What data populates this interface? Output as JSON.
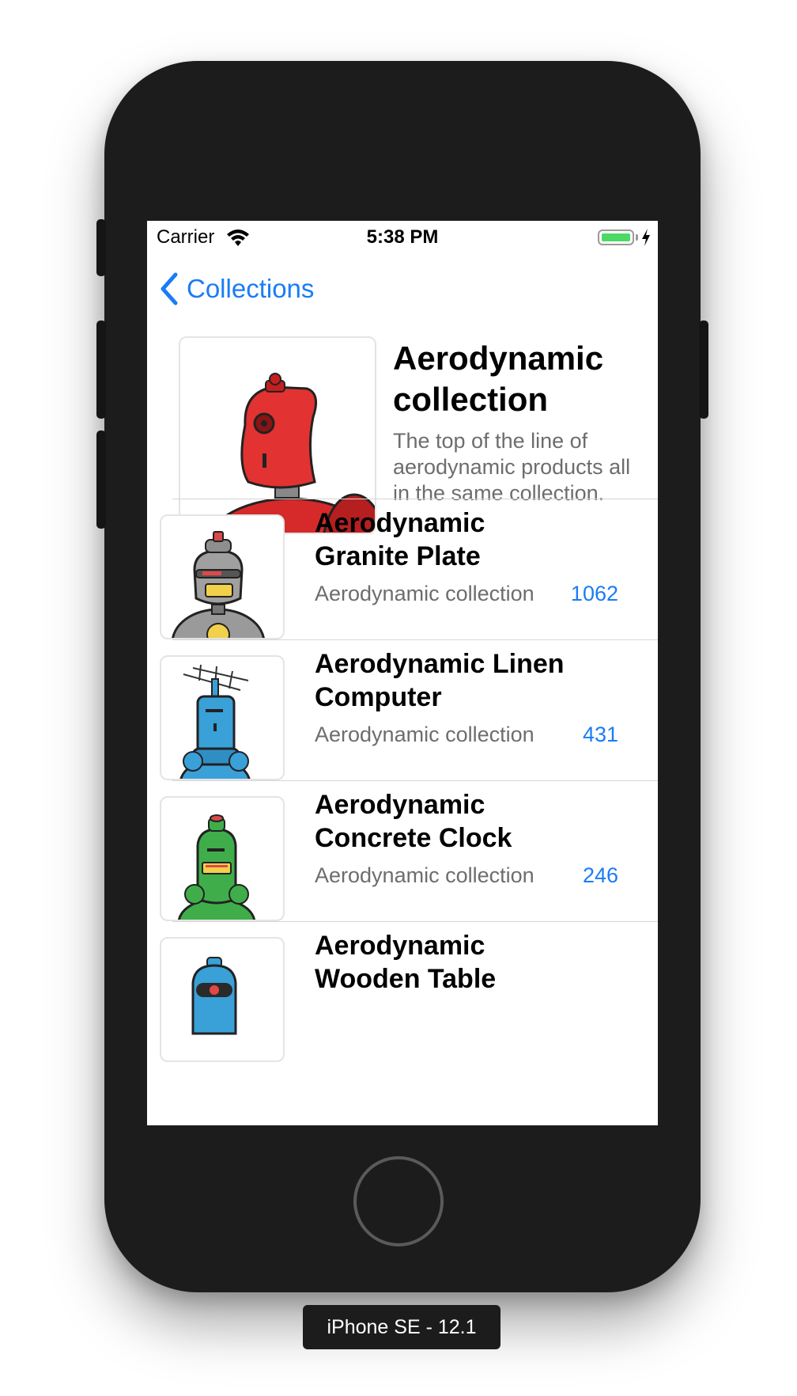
{
  "status_bar": {
    "carrier": "Carrier",
    "time": "5:38 PM"
  },
  "nav": {
    "back_label": "Collections"
  },
  "header": {
    "title": "Aerodynamic collection",
    "description": "The top of the line of aerodynamic products all in the same collection.",
    "image_icon": "red-robot-icon"
  },
  "products": [
    {
      "title": "Aerodynamic Granite Plate",
      "collection": "Aerodynamic collection",
      "count": "1062",
      "icon": "gray-robot-icon"
    },
    {
      "title": "Aerodynamic Linen Computer",
      "collection": "Aerodynamic collection",
      "count": "431",
      "icon": "blue-antenna-robot-icon"
    },
    {
      "title": "Aerodynamic Concrete Clock",
      "collection": "Aerodynamic collection",
      "count": "246",
      "icon": "green-robot-icon"
    },
    {
      "title": "Aerodynamic Wooden Table",
      "collection": "",
      "count": "",
      "icon": "blue-robot-icon"
    }
  ],
  "device": {
    "label": "iPhone SE - 12.1"
  },
  "colors": {
    "accent": "#1a7cf5",
    "battery": "#4cd964",
    "bezel": "#1c1c1c"
  }
}
